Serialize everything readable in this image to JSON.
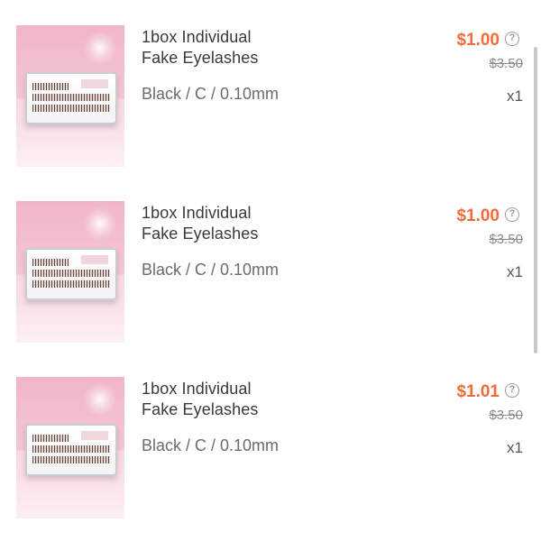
{
  "items": [
    {
      "title_line1": "1box Individual",
      "title_line2": "Fake Eyelashes",
      "variant": "Black / C / 0.10mm",
      "price": "$1.00",
      "help_glyph": "?",
      "original_price": "$3.50",
      "quantity": "x1",
      "thumbnail": "eyelash-box-on-pink-background"
    },
    {
      "title_line1": "1box Individual",
      "title_line2": "Fake Eyelashes",
      "variant": "Black / C / 0.10mm",
      "price": "$1.00",
      "help_glyph": "?",
      "original_price": "$3.50",
      "quantity": "x1",
      "thumbnail": "eyelash-box-on-pink-background"
    },
    {
      "title_line1": "1box Individual",
      "title_line2": "Fake Eyelashes",
      "variant": "Black / C / 0.10mm",
      "price": "$1.01",
      "help_glyph": "?",
      "original_price": "$3.50",
      "quantity": "x1",
      "thumbnail": "eyelash-box-on-pink-background"
    }
  ],
  "colors": {
    "price": "#f26b3a",
    "title": "#3a3a3a",
    "secondary": "#8a8a8a"
  }
}
